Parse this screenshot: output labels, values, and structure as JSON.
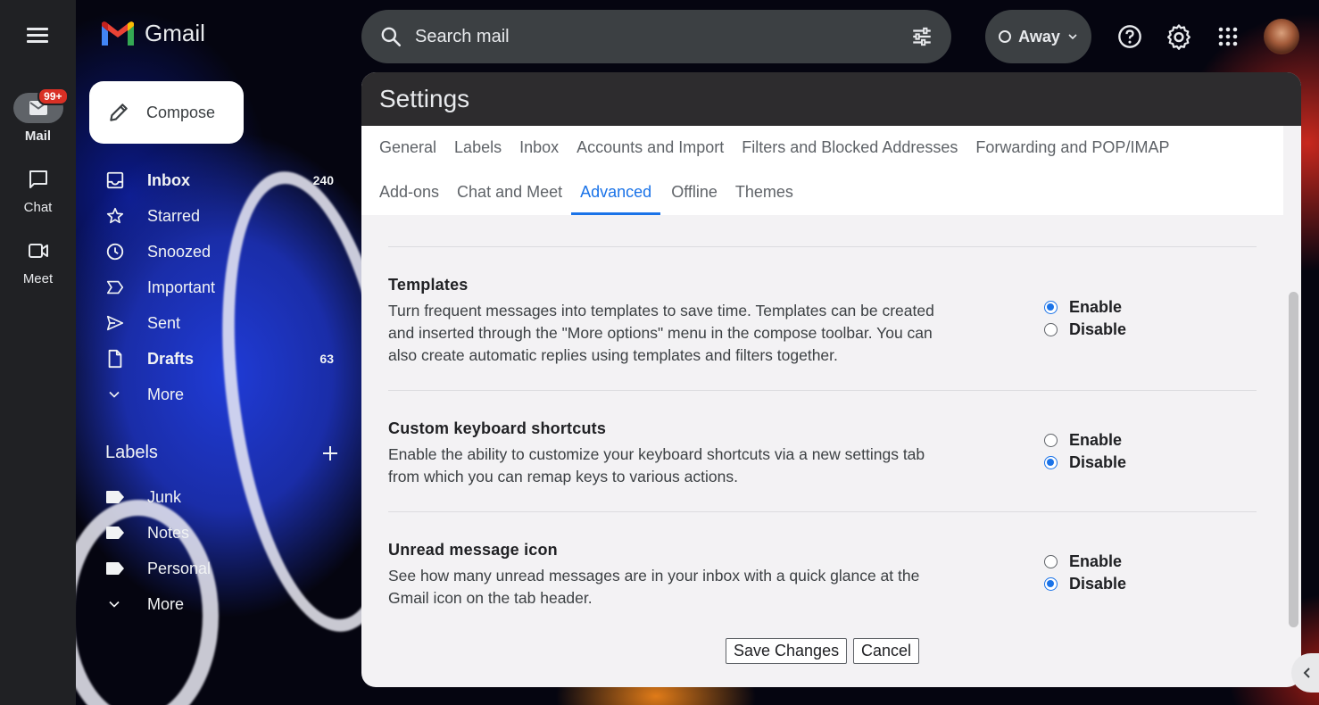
{
  "rail": {
    "items": [
      {
        "label": "Mail",
        "badge": "99+"
      },
      {
        "label": "Chat"
      },
      {
        "label": "Meet"
      }
    ]
  },
  "app": {
    "name": "Gmail"
  },
  "search": {
    "placeholder": "Search mail"
  },
  "status": {
    "label": "Away"
  },
  "compose": {
    "label": "Compose"
  },
  "nav": {
    "items": [
      {
        "label": "Inbox",
        "count": "240",
        "icon": "inbox-icon"
      },
      {
        "label": "Starred",
        "count": "",
        "icon": "star-icon"
      },
      {
        "label": "Snoozed",
        "count": "",
        "icon": "clock-icon"
      },
      {
        "label": "Important",
        "count": "",
        "icon": "important-icon"
      },
      {
        "label": "Sent",
        "count": "",
        "icon": "send-icon"
      },
      {
        "label": "Drafts",
        "count": "63",
        "icon": "draft-icon"
      },
      {
        "label": "More",
        "count": "",
        "icon": "chevron-down-icon"
      }
    ]
  },
  "labels": {
    "heading": "Labels",
    "items": [
      {
        "label": "Junk"
      },
      {
        "label": "Notes"
      },
      {
        "label": "Personal"
      },
      {
        "label": "More"
      }
    ]
  },
  "settings": {
    "title": "Settings",
    "tabs_row1": [
      "General",
      "Labels",
      "Inbox",
      "Accounts and Import",
      "Filters and Blocked Addresses",
      "Forwarding and POP/IMAP"
    ],
    "tabs_row2": [
      "Add-ons",
      "Chat and Meet",
      "Advanced",
      "Offline",
      "Themes"
    ],
    "active_tab": "Advanced",
    "sections": [
      {
        "title": "Templates",
        "desc_lines": [
          "Turn frequent messages into templates to save time. Templates can be created",
          "and inserted through the \"More options\" menu in the compose toolbar. You can",
          "also create automatic replies using templates and filters together."
        ],
        "enable_label": "Enable",
        "disable_label": "Disable",
        "selected": "Enable"
      },
      {
        "title": "Custom keyboard shortcuts",
        "desc_lines": [
          "Enable the ability to customize your keyboard shortcuts via a new settings tab",
          "from which you can remap keys to various actions."
        ],
        "enable_label": "Enable",
        "disable_label": "Disable",
        "selected": "Disable"
      },
      {
        "title": "Unread message icon",
        "desc_lines": [
          "See how many unread messages are in your inbox with a quick glance at the",
          "Gmail icon on the tab header."
        ],
        "enable_label": "Enable",
        "disable_label": "Disable",
        "selected": "Disable"
      }
    ],
    "save_label": "Save Changes",
    "cancel_label": "Cancel"
  },
  "colors": {
    "accent": "#1a73e8",
    "rail_bg": "#202124",
    "badge": "#d93025"
  }
}
